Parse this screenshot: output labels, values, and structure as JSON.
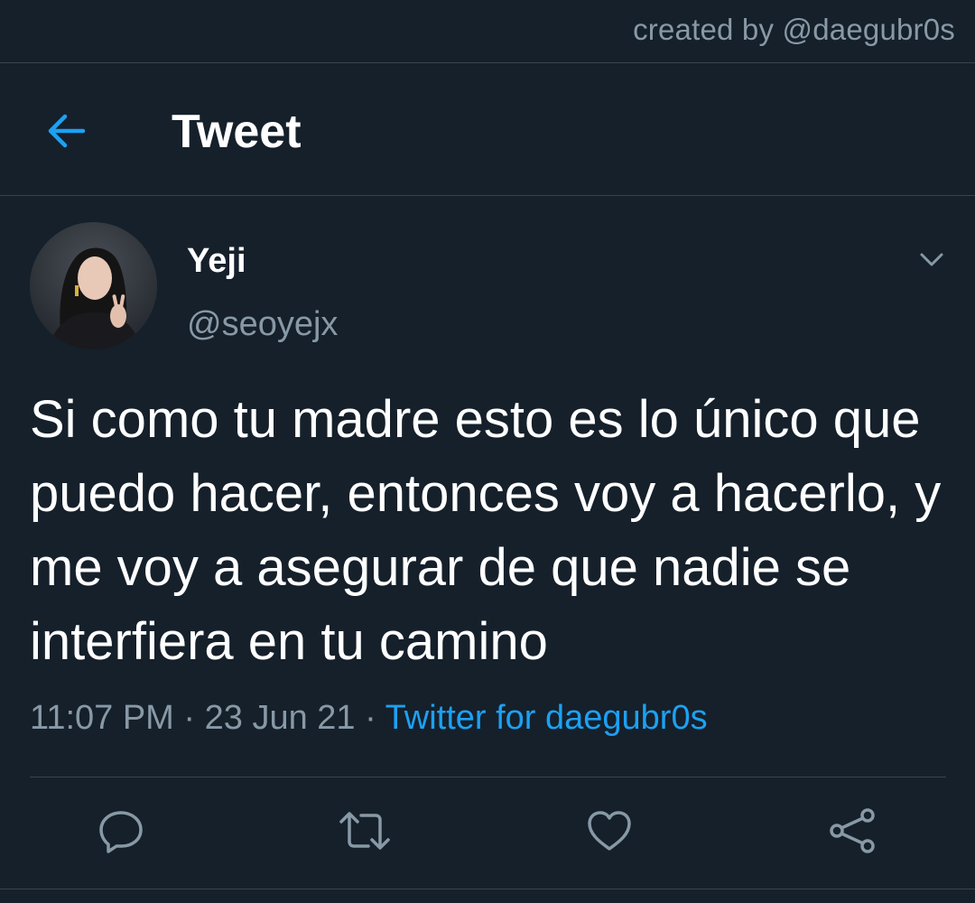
{
  "credit": "created by @daegubr0s",
  "header": {
    "title": "Tweet",
    "back_icon": "arrow-left-icon"
  },
  "tweet": {
    "author": {
      "name": "Yeji",
      "handle": "@seoyejx"
    },
    "text": "Si como tu madre esto es lo único que puedo hacer, entonces voy a hacerlo, y me voy a asegurar de que nadie se interfiera en tu camino",
    "time": "11:07 PM",
    "date": "23 Jun 21",
    "separator": "·",
    "source": "Twitter for daegubr0s"
  },
  "actions": [
    {
      "icon": "reply-icon"
    },
    {
      "icon": "retweet-icon"
    },
    {
      "icon": "like-icon"
    },
    {
      "icon": "share-icon"
    }
  ],
  "colors": {
    "background": "#15202b",
    "divider": "#38444d",
    "secondary_text": "#8899a6",
    "accent": "#1da1f2"
  }
}
